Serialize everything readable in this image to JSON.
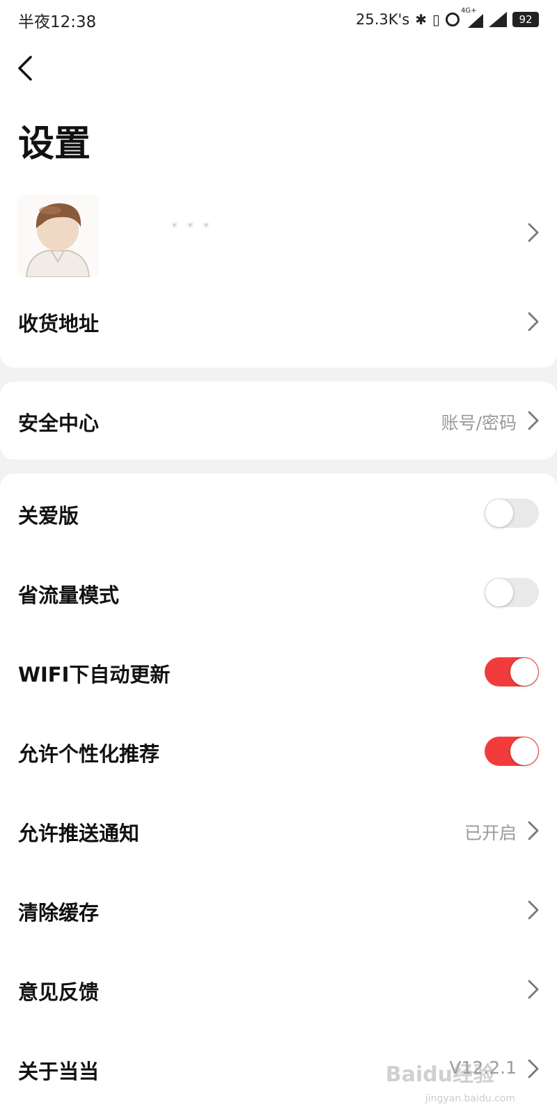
{
  "status_bar": {
    "time": "半夜12:38",
    "net_speed": "25.3K's",
    "network_type": "4G+",
    "battery": "92"
  },
  "header": {
    "title": "设置"
  },
  "profile": {
    "name": "* *    *"
  },
  "rows": {
    "address": {
      "label": "收货地址"
    },
    "security": {
      "label": "安全中心",
      "value": "账号/密码"
    },
    "care_mode": {
      "label": "关爱版",
      "enabled": false
    },
    "data_saver": {
      "label": "省流量模式",
      "enabled": false
    },
    "wifi_update": {
      "label": "WIFI下自动更新",
      "enabled": true
    },
    "personalized": {
      "label": "允许个性化推荐",
      "enabled": true
    },
    "push": {
      "label": "允许推送通知",
      "value": "已开启"
    },
    "clear_cache": {
      "label": "清除缓存"
    },
    "feedback": {
      "label": "意见反馈"
    },
    "about": {
      "label": "关于当当",
      "value": "V12.2.1"
    }
  },
  "watermark": {
    "text": "Baidu经验",
    "url_text": "jingyan.baidu.com"
  },
  "colors": {
    "toggle_on": "#f23c3c",
    "toggle_off": "#e9e9e9",
    "background": "#f2f2f2",
    "secondary_text": "#9a9a9a"
  }
}
